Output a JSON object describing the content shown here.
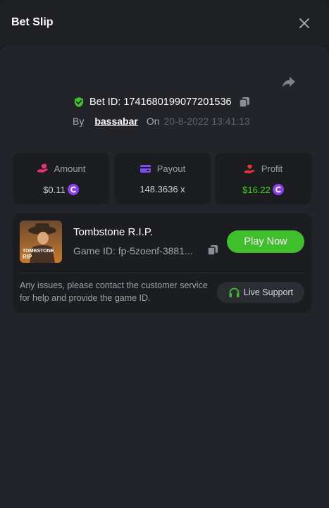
{
  "header": {
    "title": "Bet Slip",
    "close_icon": "close-icon"
  },
  "bet": {
    "id_label": "Bet ID: 1741680199077201536",
    "by_label": "By",
    "username": "bassabar",
    "on_label": "On",
    "datetime": "20-8-2022 13:41:13"
  },
  "stats": {
    "amount": {
      "label": "Amount",
      "value": "$0.11",
      "icon": "hand-coins-icon"
    },
    "payout": {
      "label": "Payout",
      "value": "148.3636 x",
      "icon": "wallet-icon"
    },
    "profit": {
      "label": "Profit",
      "value": "$16.22",
      "icon": "hand-heart-icon"
    }
  },
  "game": {
    "name": "Tombstone R.I.P.",
    "id_text": "Game ID: fp-5zoenf-3881...",
    "play_label": "Play Now",
    "thumb_text": "TOMBSTONE",
    "thumb_text2": "RIP"
  },
  "support": {
    "message": "Any issues, please contact the customer service for help and provide the game ID.",
    "button_label": "Live Support"
  },
  "colors": {
    "accent_green": "#3fbf2b",
    "profit_green": "#3fd420",
    "coin_purple": "#8b3ff0",
    "amount_pink": "#e8336b",
    "payout_purple": "#7a4cf0",
    "profit_red": "#e8333a"
  }
}
